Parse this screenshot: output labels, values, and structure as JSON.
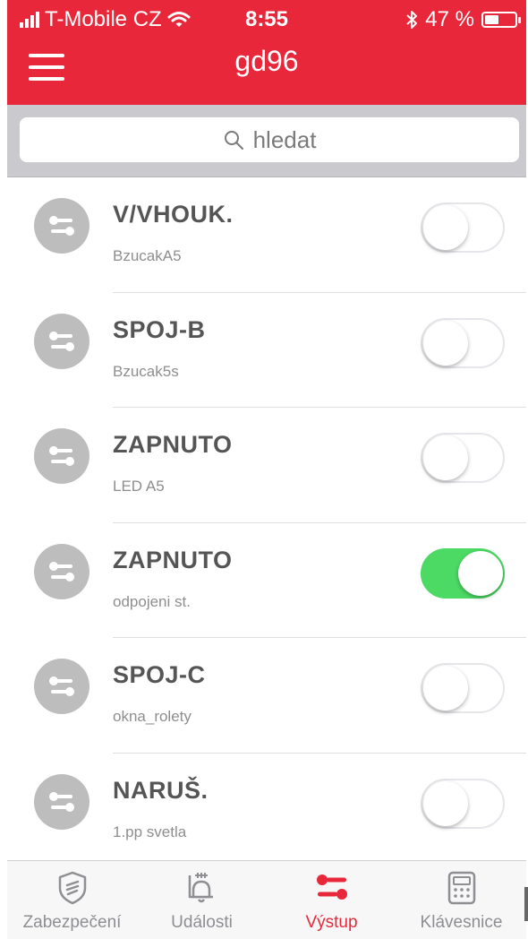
{
  "status_bar": {
    "carrier": "T-Mobile CZ",
    "time": "8:55",
    "battery": "47 %",
    "battery_level": 0.47
  },
  "header": {
    "title": "gd96"
  },
  "search": {
    "placeholder": "hledat"
  },
  "outputs": [
    {
      "title": "V/VHOUK.",
      "subtitle": "BzucakA5",
      "on": false
    },
    {
      "title": "SPOJ-B",
      "subtitle": "Bzucak5s",
      "on": false
    },
    {
      "title": "ZAPNUTO",
      "subtitle": "LED A5",
      "on": false
    },
    {
      "title": "ZAPNUTO",
      "subtitle": "odpojeni st.",
      "on": true
    },
    {
      "title": "SPOJ-C",
      "subtitle": "okna_rolety",
      "on": false
    },
    {
      "title": "NARUŠ.",
      "subtitle": "1.pp svetla",
      "on": false
    }
  ],
  "tabs": [
    {
      "label": "Zabezpečení",
      "icon": "shield-icon",
      "active": false
    },
    {
      "label": "Události",
      "icon": "bell-icon",
      "active": false
    },
    {
      "label": "Výstup",
      "icon": "toggles-icon",
      "active": true
    },
    {
      "label": "Klávesnice",
      "icon": "keypad-icon",
      "active": false
    }
  ],
  "colors": {
    "accent": "#e8283a",
    "toggle_on": "#4cd964",
    "avatar": "#bdbdbd"
  }
}
